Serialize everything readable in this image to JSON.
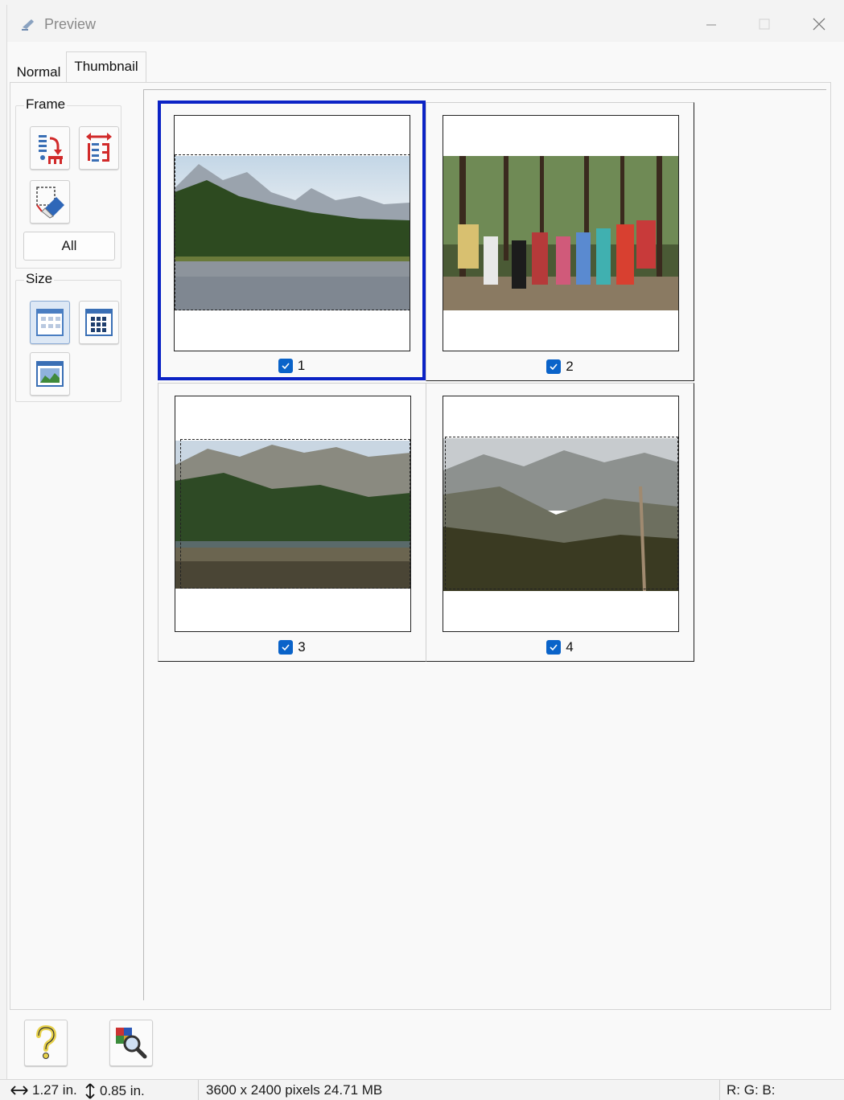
{
  "window": {
    "title": "Preview"
  },
  "tabs": [
    {
      "label": "Normal",
      "active": false
    },
    {
      "label": "Thumbnail",
      "active": true
    }
  ],
  "sidebar": {
    "frame_group": {
      "label": "Frame",
      "buttons": [
        "select-frames-icon",
        "rotate-frames-icon",
        "erase-marquee-icon"
      ],
      "all_label": "All"
    },
    "size_group": {
      "label": "Size",
      "buttons": [
        "small-thumbnails-icon",
        "medium-thumbnails-icon",
        "large-thumbnail-icon"
      ],
      "selected": "small-thumbnails-icon"
    }
  },
  "thumbnails": [
    {
      "number": "1",
      "checked": true,
      "selected": true,
      "scene": "mountain-lake"
    },
    {
      "number": "2",
      "checked": true,
      "selected": false,
      "scene": "hikers-in-forest"
    },
    {
      "number": "3",
      "checked": true,
      "selected": false,
      "scene": "forest-lake"
    },
    {
      "number": "4",
      "checked": true,
      "selected": false,
      "scene": "mountain-valley"
    }
  ],
  "footer": {
    "help_icon": "question-mark-icon",
    "zoom_icon": "magnifier-icon"
  },
  "status": {
    "width": "1.27 in.",
    "height": "0.85 in.",
    "image_info": "3600 x 2400 pixels 24.71 MB",
    "rgb": "R: G: B:"
  },
  "colors": {
    "selection_border": "#0b23c5",
    "checkbox": "#0a63c9"
  }
}
